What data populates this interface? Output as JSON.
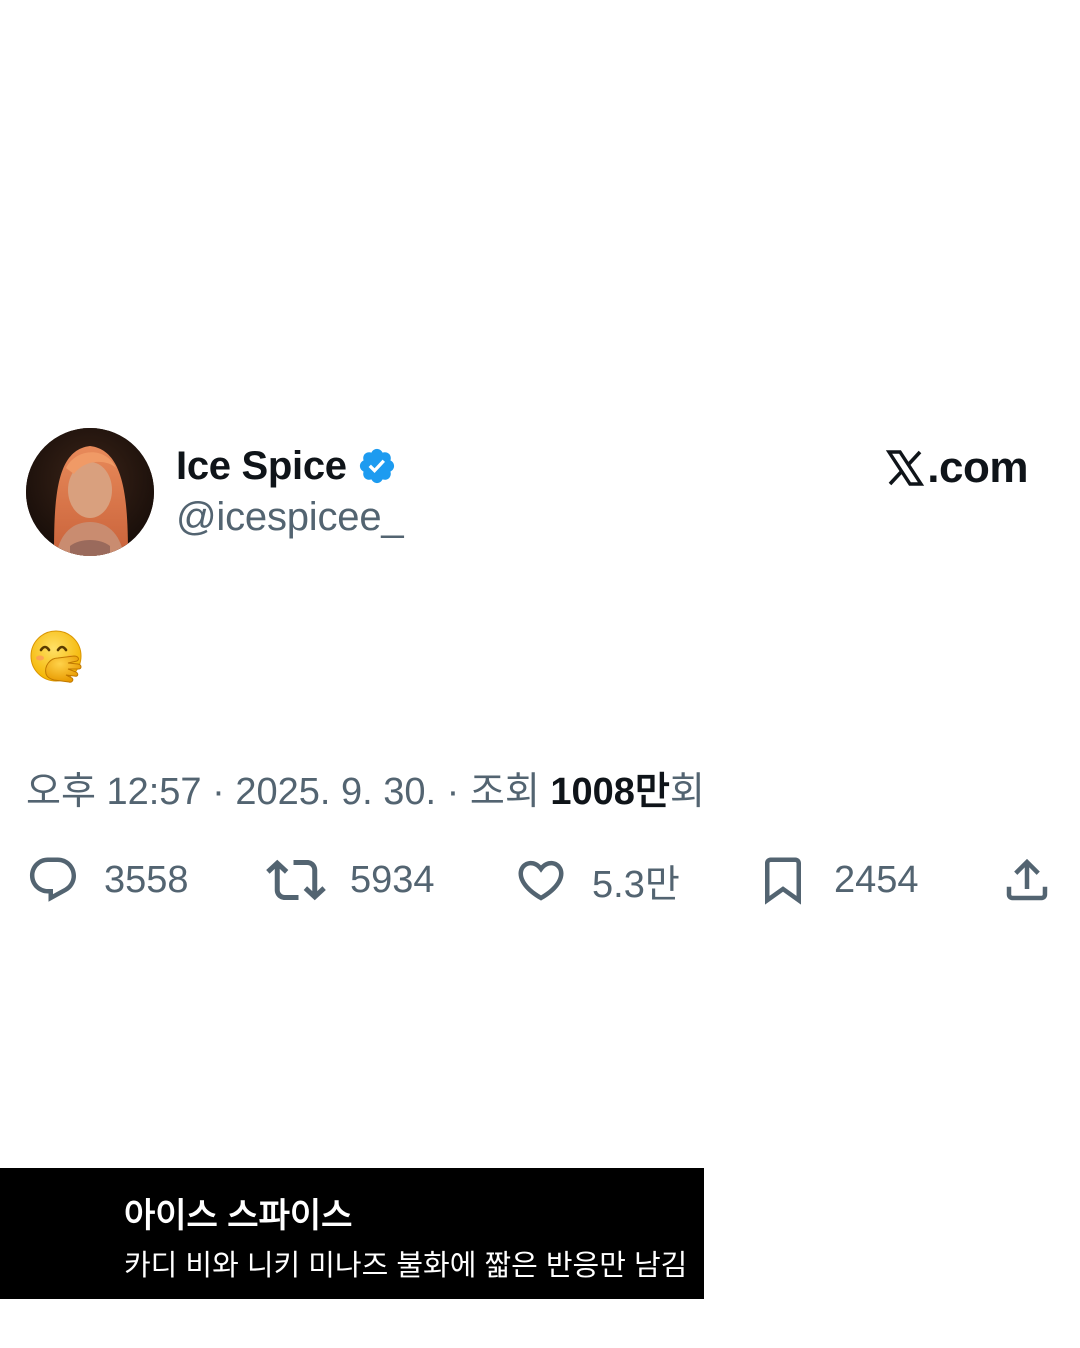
{
  "tweet": {
    "display_name": "Ice Spice",
    "handle": "@icespicee_",
    "verified": true,
    "site_label": ".com",
    "body_emoji": "face-with-hand-over-mouth",
    "meta": {
      "time": "오후 12:57",
      "separator": "·",
      "date": "2025. 9. 30.",
      "views_label": "조회",
      "views_count": "1008만",
      "views_suffix": "회"
    },
    "actions": {
      "replies": "3558",
      "reposts": "5934",
      "likes": "5.3만",
      "bookmarks": "2454"
    }
  },
  "caption": {
    "title": "아이스 스파이스",
    "subtitle": "카디 비와 니키 미나즈 불화에 짧은 반응만 남김"
  },
  "colors": {
    "text_primary": "#0f1419",
    "text_secondary": "#536471",
    "verified_blue": "#1d9bf0",
    "caption_background": "#000000"
  },
  "icons": [
    "verified-badge-icon",
    "x-logo-icon",
    "reply-icon",
    "repost-icon",
    "like-icon",
    "bookmark-icon",
    "share-icon"
  ]
}
